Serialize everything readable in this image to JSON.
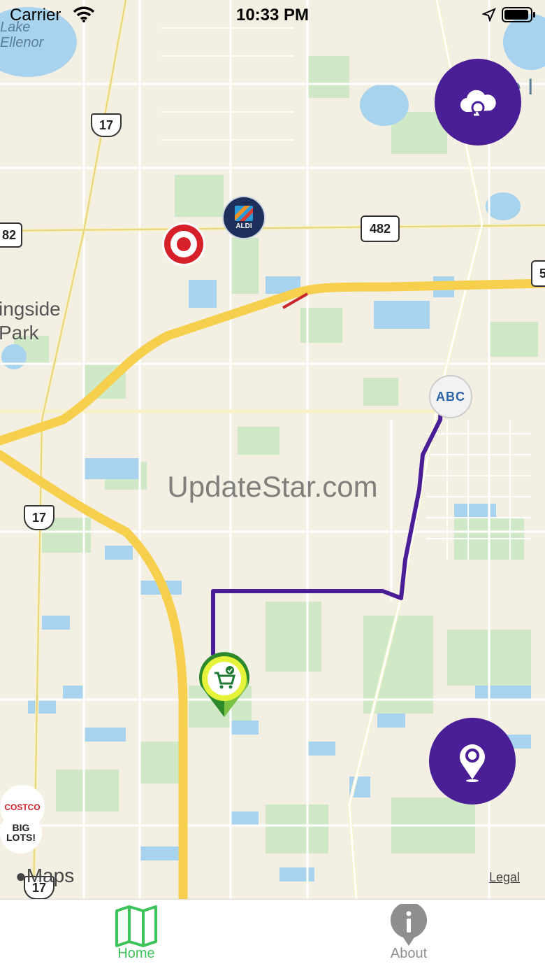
{
  "status_bar": {
    "carrier": "Carrier",
    "time": "10:33 PM"
  },
  "map": {
    "labels": {
      "lake": "Lake\nEllenor",
      "park_line1": "ingside",
      "park_line2": "Park",
      "lake_right": "e I"
    },
    "road_shields": {
      "us17_top": "17",
      "sr482_left": "82",
      "sr482_right": "482",
      "us17_mid": "17",
      "us17_bottom": "17",
      "right_edge": "5"
    },
    "poi": {
      "aldi": "ALDI",
      "abc": "ABC",
      "costco": "COSTCO",
      "biglots": "BIG LOTS!"
    },
    "watermark": "UpdateStar.com",
    "attribution": "Maps",
    "legal": "Legal"
  },
  "tabs": [
    {
      "label": "Home",
      "icon": "map-icon",
      "active": true
    },
    {
      "label": "About",
      "icon": "info-icon",
      "active": false
    }
  ],
  "colors": {
    "accent": "#4a1e96",
    "tab_active": "#3cc35a",
    "tab_inactive": "#8e8e8e",
    "route": "#4a1e96",
    "highway": "#f6d04d"
  }
}
